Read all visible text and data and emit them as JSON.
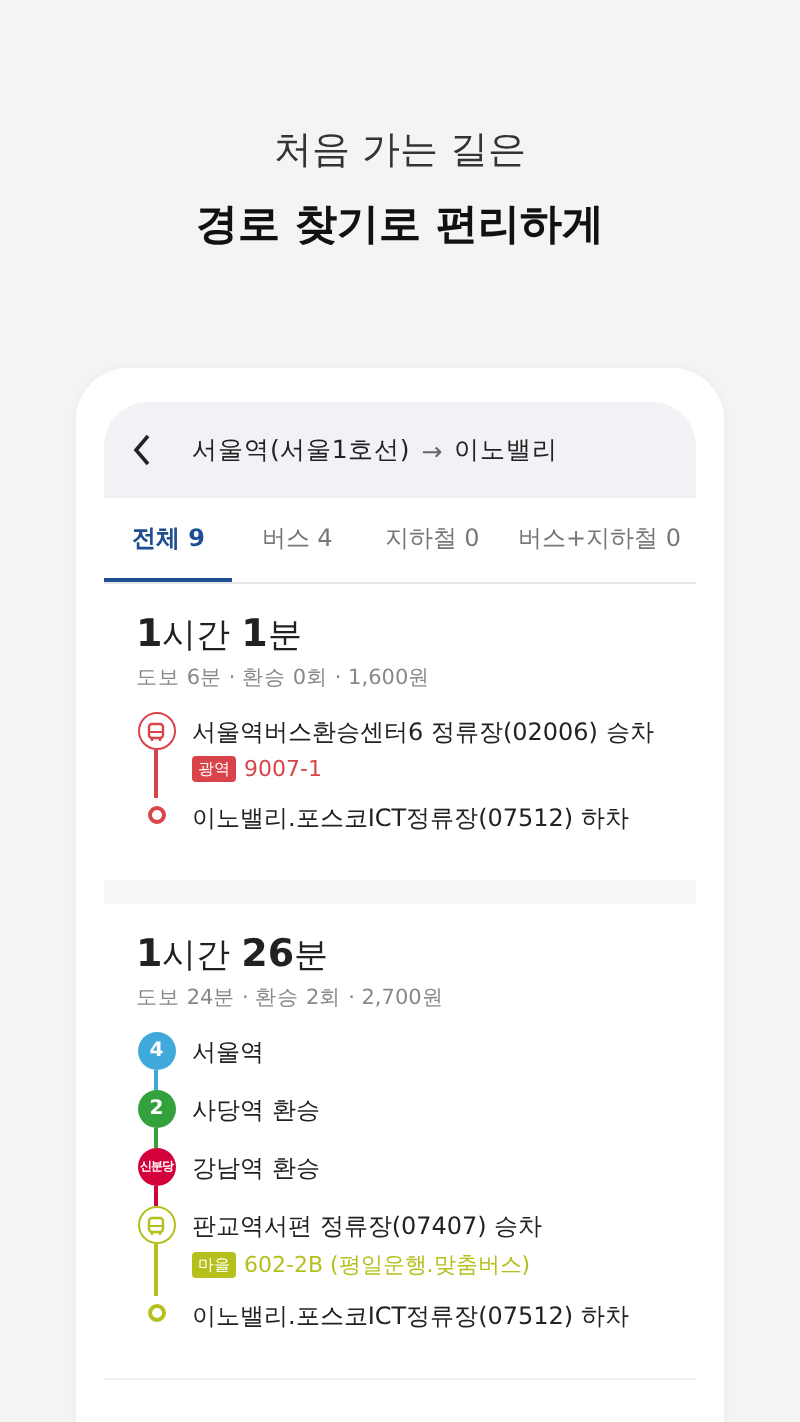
{
  "headline": {
    "subtitle": "처음 가는 길은",
    "title": "경로 찾기로 편리하게"
  },
  "search_header": {
    "origin": "서울역(서울1호선)",
    "arrow": "→",
    "destination": "이노밸리"
  },
  "tabs": [
    {
      "label": "전체 9",
      "selected": true
    },
    {
      "label": "버스 4",
      "selected": false
    },
    {
      "label": "지하철 0",
      "selected": false
    },
    {
      "label": "버스+지하철 0",
      "selected": false
    }
  ],
  "routes": [
    {
      "duration": "**1**시간 **1**분",
      "summary": "도보 6분 · 환승 0회 · 1,600원",
      "steps": [
        {
          "kind": "bus",
          "color": "#d9434a",
          "text": "서울역버스환승센터6 정류장(02006) 승차",
          "badge": "광역",
          "line": "9007-1"
        },
        {
          "kind": "end",
          "color": "#d9434a",
          "text": "이노밸리.포스코ICT정류장(07512) 하차"
        }
      ]
    },
    {
      "duration": "**1**시간 **26**분",
      "summary": "도보 24분 · 환승 2회 · 2,700원",
      "steps": [
        {
          "kind": "subway",
          "color": "#3fa9dc",
          "label": "4",
          "text": "서울역"
        },
        {
          "kind": "subway",
          "color": "#33a23d",
          "label": "2",
          "text": "사당역 환승"
        },
        {
          "kind": "subway",
          "color": "#d4003b",
          "label": "신분당",
          "text": "강남역 환승"
        },
        {
          "kind": "bus",
          "color": "#b5c01d",
          "text": "판교역서편 정류장(07407) 승차",
          "badge": "마을",
          "line": "602-2B (평일운행.맞춤버스)"
        },
        {
          "kind": "end",
          "color": "#b5c01d",
          "text": "이노밸리.포스코ICT정류장(07512) 하차"
        }
      ]
    }
  ]
}
